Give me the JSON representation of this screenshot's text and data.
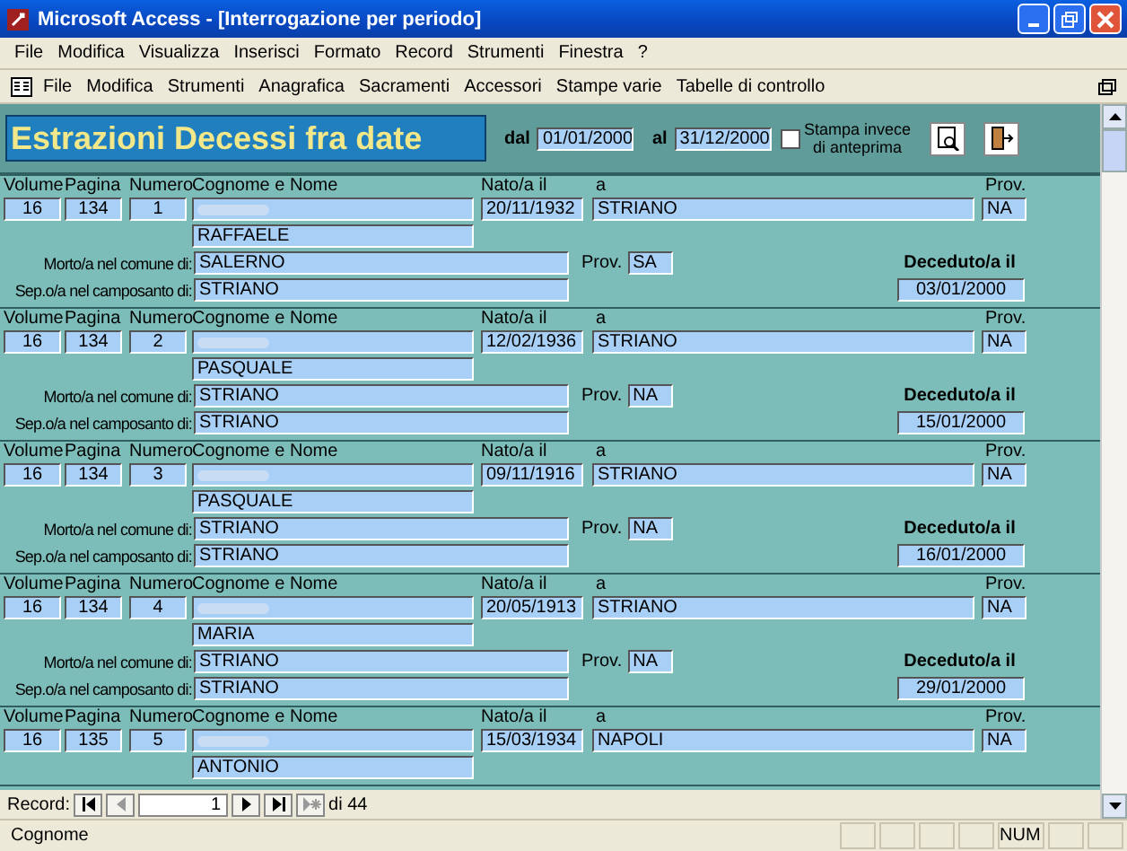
{
  "window": {
    "title": "Microsoft Access - [Interrogazione per periodo]"
  },
  "menu": [
    {
      "label": "File"
    },
    {
      "label": "Modifica"
    },
    {
      "label": "Visualizza"
    },
    {
      "label": "Inserisci"
    },
    {
      "label": "Formato"
    },
    {
      "label": "Record"
    },
    {
      "label": "Strumenti"
    },
    {
      "label": "Finestra"
    },
    {
      "label": "?"
    }
  ],
  "toolbar": [
    {
      "label": "File"
    },
    {
      "label": "Modifica"
    },
    {
      "label": "Strumenti"
    },
    {
      "label": "Anagrafica"
    },
    {
      "label": "Sacramenti"
    },
    {
      "label": "Accessori"
    },
    {
      "label": "Stampe varie"
    },
    {
      "label": "Tabelle di controllo"
    }
  ],
  "form_header": {
    "title": "Estrazioni Decessi fra date",
    "from_label": "dal",
    "from_value": "01/01/2000",
    "to_label": "al",
    "to_value": "31/12/2000",
    "print_checkbox": {
      "label": "Stampa invece di anteprima",
      "checked": false
    }
  },
  "records": [
    {
      "headings": [
        "Volume",
        "Pagina",
        "Numero",
        "Cognome e Nome",
        "Nato/a il",
        "a",
        "Prov."
      ],
      "volume": "16",
      "pagina": "134",
      "numero": "1",
      "first_name": "RAFFAELE",
      "born_date": "20/11/1932",
      "born_place": "STRIANO",
      "born_prov": "NA",
      "died_label": "Morto/a nel comune di:",
      "died_place": "SALERNO",
      "prov_label": "Prov.",
      "died_prov": "SA",
      "cemetery_label": "Sep.o/a nel camposanto di:",
      "cemetery": "STRIANO",
      "death_label": "Deceduto/a il",
      "death_date": "03/01/2000"
    },
    {
      "headings": [
        "Volume",
        "Pagina",
        "Numero",
        "Cognome e Nome",
        "Nato/a il",
        "a",
        "Prov."
      ],
      "volume": "16",
      "pagina": "134",
      "numero": "2",
      "first_name": "PASQUALE",
      "born_date": "12/02/1936",
      "born_place": "STRIANO",
      "born_prov": "NA",
      "died_label": "Morto/a nel comune di:",
      "died_place": "STRIANO",
      "prov_label": "Prov.",
      "died_prov": "NA",
      "cemetery_label": "Sep.o/a nel camposanto di:",
      "cemetery": "STRIANO",
      "death_label": "Deceduto/a il",
      "death_date": "15/01/2000"
    },
    {
      "headings": [
        "Volume",
        "Pagina",
        "Numero",
        "Cognome e Nome",
        "Nato/a il",
        "a",
        "Prov."
      ],
      "volume": "16",
      "pagina": "134",
      "numero": "3",
      "first_name": "PASQUALE",
      "born_date": "09/11/1916",
      "born_place": "STRIANO",
      "born_prov": "NA",
      "died_label": "Morto/a nel comune di:",
      "died_place": "STRIANO",
      "prov_label": "Prov.",
      "died_prov": "NA",
      "cemetery_label": "Sep.o/a nel camposanto di:",
      "cemetery": "STRIANO",
      "death_label": "Deceduto/a il",
      "death_date": "16/01/2000"
    },
    {
      "headings": [
        "Volume",
        "Pagina",
        "Numero",
        "Cognome e Nome",
        "Nato/a il",
        "a",
        "Prov."
      ],
      "volume": "16",
      "pagina": "134",
      "numero": "4",
      "first_name": "MARIA",
      "born_date": "20/05/1913",
      "born_place": "STRIANO",
      "born_prov": "NA",
      "died_label": "Morto/a nel comune di:",
      "died_place": "STRIANO",
      "prov_label": "Prov.",
      "died_prov": "NA",
      "cemetery_label": "Sep.o/a nel camposanto di:",
      "cemetery": "STRIANO",
      "death_label": "Deceduto/a il",
      "death_date": "29/01/2000"
    },
    {
      "headings": [
        "Volume",
        "Pagina",
        "Numero",
        "Cognome e Nome",
        "Nato/a il",
        "a",
        "Prov."
      ],
      "volume": "16",
      "pagina": "135",
      "numero": "5",
      "first_name": "ANTONIO",
      "born_date": "15/03/1934",
      "born_place": "NAPOLI",
      "born_prov": "NA"
    }
  ],
  "navigation": {
    "label": "Record:",
    "current": "1",
    "total": "di 44"
  },
  "status_bar": {
    "text": "Cognome",
    "indicator": "NUM"
  }
}
